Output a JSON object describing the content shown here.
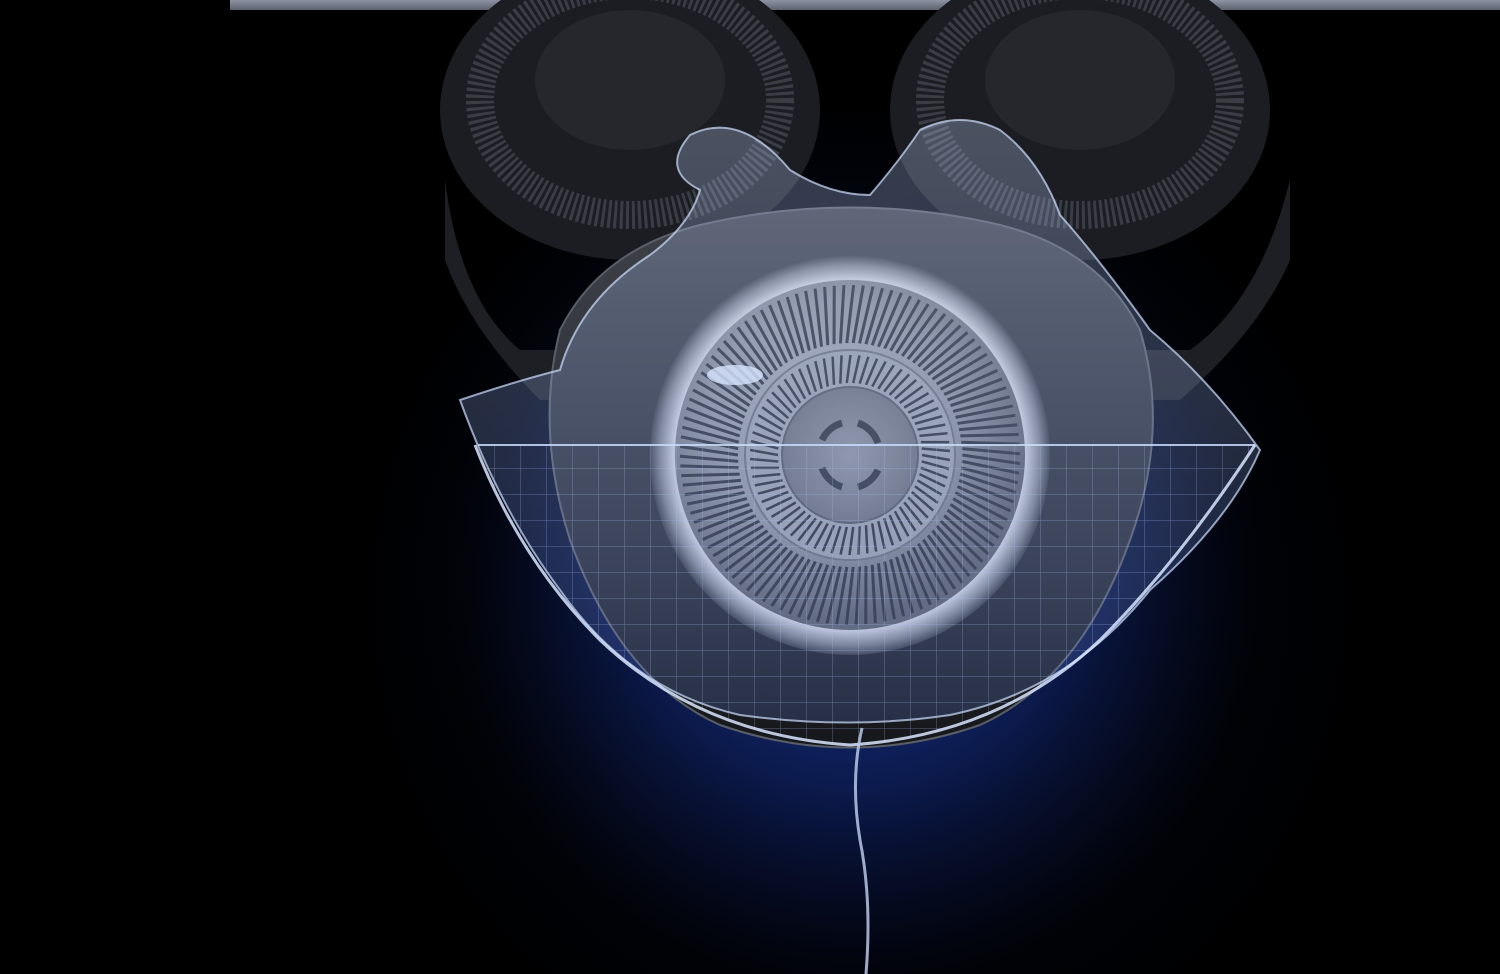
{
  "image": {
    "subject": "shaver-head-icon",
    "colors": {
      "background": "#000000",
      "glow": "#1a3a9a",
      "metal": "#8e9299",
      "membrane": "#b9d2ff",
      "grid": "#9fbaff"
    }
  }
}
